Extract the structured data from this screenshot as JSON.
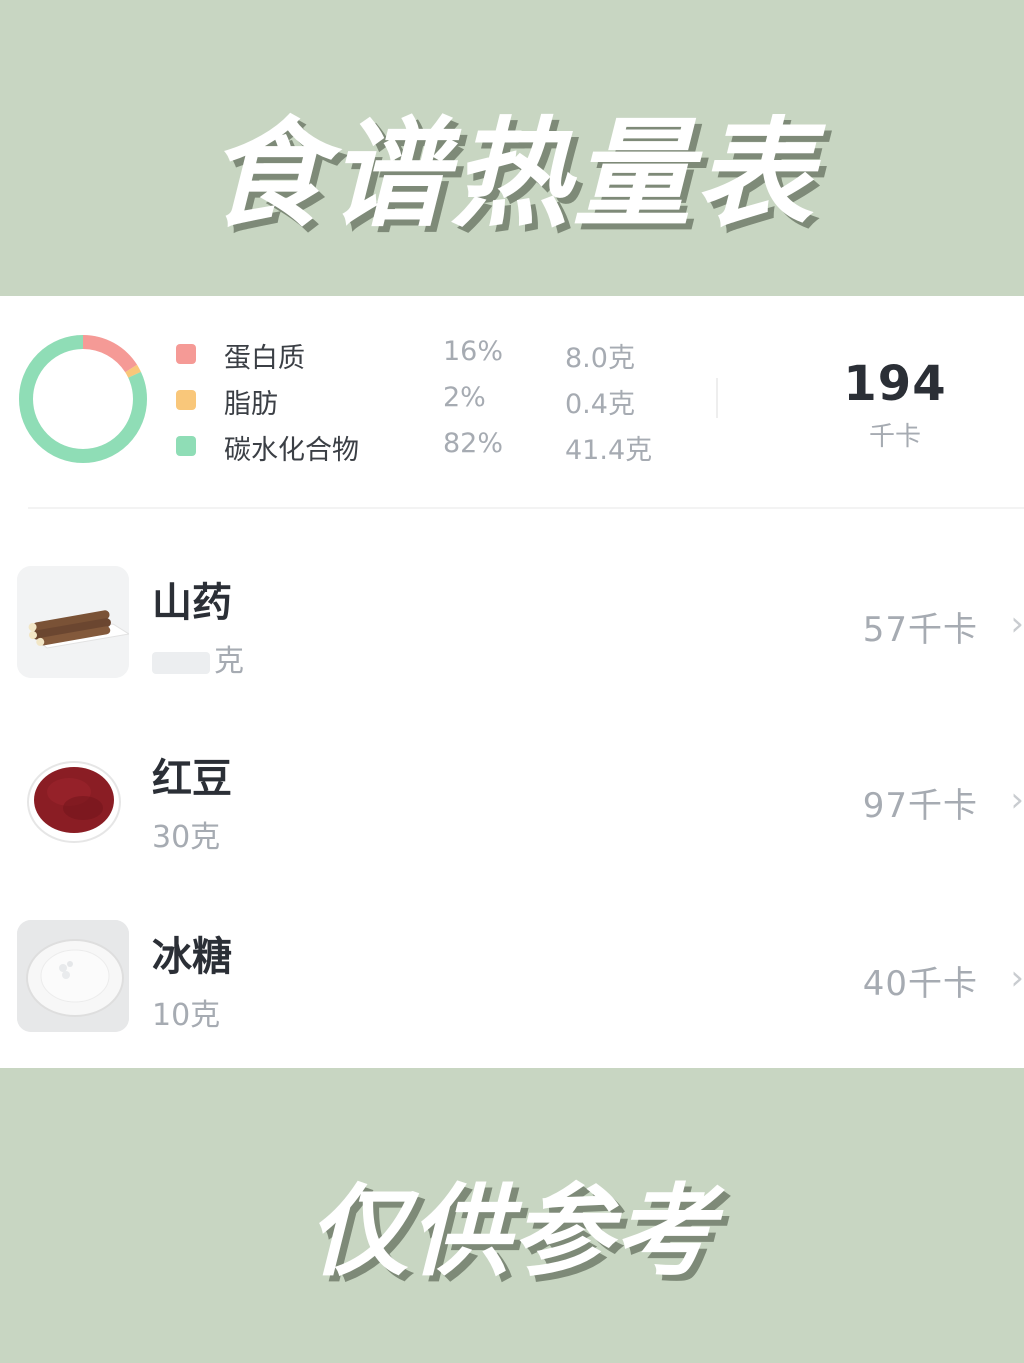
{
  "banner": {
    "title": "食谱热量表",
    "footer": "仅供参考"
  },
  "summary": {
    "macros": [
      {
        "name": "蛋白质",
        "percent": "16%",
        "grams": "8.0克",
        "color": "#f59a96",
        "share": 0.16
      },
      {
        "name": "脂肪",
        "percent": "2%",
        "grams": "0.4克",
        "color": "#f9c77a",
        "share": 0.02
      },
      {
        "name": "碳水化合物",
        "percent": "82%",
        "grams": "41.4克",
        "color": "#8fddb6",
        "share": 0.82
      }
    ],
    "total_value": "194",
    "total_unit": "千卡"
  },
  "foods": [
    {
      "name": "山药",
      "amount": "克",
      "amount_obscured": true,
      "kcal": "57千卡",
      "icon": "chinese-yam-image"
    },
    {
      "name": "红豆",
      "amount": "30克",
      "amount_obscured": false,
      "kcal": "97千卡",
      "icon": "red-bean-image"
    },
    {
      "name": "冰糖",
      "amount": "10克",
      "amount_obscured": false,
      "kcal": "40千卡",
      "icon": "rock-sugar-image"
    }
  ],
  "chevron_glyph": "›"
}
